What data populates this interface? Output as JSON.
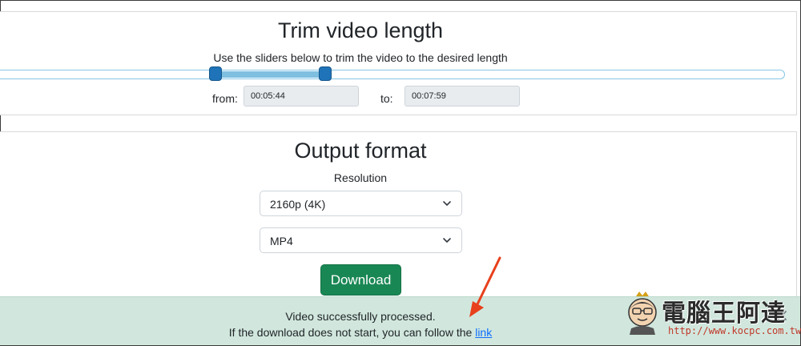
{
  "trim": {
    "title": "Trim video length",
    "subtitle": "Use the sliders below to trim the video to the desired length",
    "from_label": "from:",
    "from_value": "00:05:44",
    "to_label": "to:",
    "to_value": "00:07:59"
  },
  "output": {
    "title": "Output format",
    "resolution_label": "Resolution",
    "resolution_selected": "2160p (4K)",
    "format_selected": "MP4",
    "download_label": "Download"
  },
  "alert": {
    "line1": "Video successfully processed.",
    "line2_prefix": "If the download does not start, you can follow the ",
    "link_text": "link"
  },
  "watermark": {
    "brand": "電腦王阿達",
    "url": "http://www.kocpc.com.tw"
  },
  "colors": {
    "success": "#198754",
    "alert_bg": "#d1e7dd",
    "slider_handle": "#1f73b8",
    "slider_range": "#7fbfe0",
    "annotation_arrow": "#e8401c"
  }
}
